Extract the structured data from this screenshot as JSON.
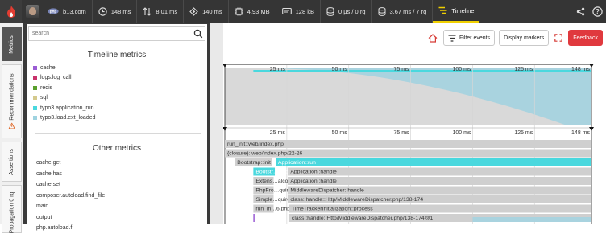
{
  "toolbar": {
    "host": "b13.com",
    "metrics": [
      {
        "icon": "clock-icon",
        "value": "148 ms"
      },
      {
        "icon": "arrows-vertical-icon",
        "value": "8.01 ms"
      },
      {
        "icon": "cpu-icon",
        "value": "140 ms"
      },
      {
        "icon": "memory-icon",
        "value": "4.93 MB"
      },
      {
        "icon": "network-icon",
        "value": "128 kB"
      },
      {
        "icon": "database-icon",
        "value": "0 μs / 0 rq"
      },
      {
        "icon": "database-icon",
        "value": "3.67 ms / 7 rq"
      }
    ],
    "timeline_tab": "Timeline",
    "colors": {
      "background": "#353535",
      "active_underline": "#f0d000",
      "logo": "#e33d32"
    }
  },
  "side_tabs": [
    "Metrics",
    "Recommendations",
    "Assertions",
    "Propagation 0 rq"
  ],
  "left_panel": {
    "search_placeholder": "search",
    "timeline_metrics_title": "Timeline metrics",
    "timeline_metrics": [
      {
        "label": "cache",
        "color": "#9a5cd4"
      },
      {
        "label": "logs.log_call",
        "color": "#c8326b"
      },
      {
        "label": "redis",
        "color": "#5aa02c"
      },
      {
        "label": "sql",
        "color": "#d4c98c"
      },
      {
        "label": "typo3.application_run",
        "color": "#4ad8de"
      },
      {
        "label": "typo3.load.ext_loaded",
        "color": "#9fd3e0"
      }
    ],
    "other_metrics_title": "Other metrics",
    "other_metrics": [
      "cache.get",
      "cache.has",
      "cache.set",
      "composer.autoload.find_file",
      "main",
      "output",
      "php.autoload.f"
    ]
  },
  "buttons": {
    "filter": "Filter events",
    "markers": "Display markers",
    "feedback": "Feedback"
  },
  "timeline": {
    "ticks": [
      "25 ms",
      "50 ms",
      "75 ms",
      "100 ms",
      "125 ms",
      "148 ms"
    ],
    "tick_values": [
      25,
      50,
      75,
      100,
      125,
      148
    ],
    "duration_ms": 148,
    "spans": [
      {
        "label": "run_init::web/index.php",
        "start": 0,
        "end": 148,
        "depth": 0,
        "color": "#cfcfcf"
      },
      {
        "label": "{closure}::web/index.php/22-26",
        "start": 0,
        "end": 148,
        "depth": 1,
        "color": "#cfcfcf"
      },
      {
        "label": "Bootstrap::init",
        "start": 4,
        "end": 19.5,
        "depth": 2,
        "color": "#cfcfcf"
      },
      {
        "label": "Application::run",
        "start": 20.5,
        "end": 148,
        "depth": 2,
        "color": "#4ad8de"
      },
      {
        "label": "Bootstr…alconf",
        "start": 11.5,
        "end": 20.5,
        "depth": 3,
        "color": "#4ad8de"
      },
      {
        "label": "Application::handle",
        "start": 25.5,
        "end": 148,
        "depth": 3,
        "color": "#cfcfcf"
      },
      {
        "label": "Extens…alconf",
        "start": 11.5,
        "end": 20,
        "depth": 4,
        "color": "#cfcfcf"
      },
      {
        "label": "Application::handle",
        "start": 25.5,
        "end": 148,
        "depth": 4,
        "color": "#cfcfcf"
      },
      {
        "label": "PhpFro…quire",
        "start": 11.5,
        "end": 20,
        "depth": 5,
        "color": "#cfcfcf"
      },
      {
        "label": "MiddlewareDispatcher::handle",
        "start": 25.5,
        "end": 148,
        "depth": 5,
        "color": "#cfcfcf"
      },
      {
        "label": "Simple…quire",
        "start": 11.5,
        "end": 20,
        "depth": 6,
        "color": "#cfcfcf"
      },
      {
        "label": "class::handle::Http/MiddlewareDispatcher.php/138-174",
        "start": 25.5,
        "end": 148,
        "depth": 6,
        "color": "#cfcfcf"
      },
      {
        "label": "run_in…6.php",
        "start": 11.5,
        "end": 20,
        "depth": 7,
        "color": "#cfcfcf"
      },
      {
        "label": "TimeTrackerInitialization::process",
        "start": 26,
        "end": 148,
        "depth": 7,
        "color": "#cfcfcf"
      },
      {
        "label": "class::handle::Http/MiddlewareDispatcher.php/138-174@1",
        "start": 26,
        "end": 148,
        "depth": 8,
        "color": "#cfcfcf"
      }
    ]
  }
}
